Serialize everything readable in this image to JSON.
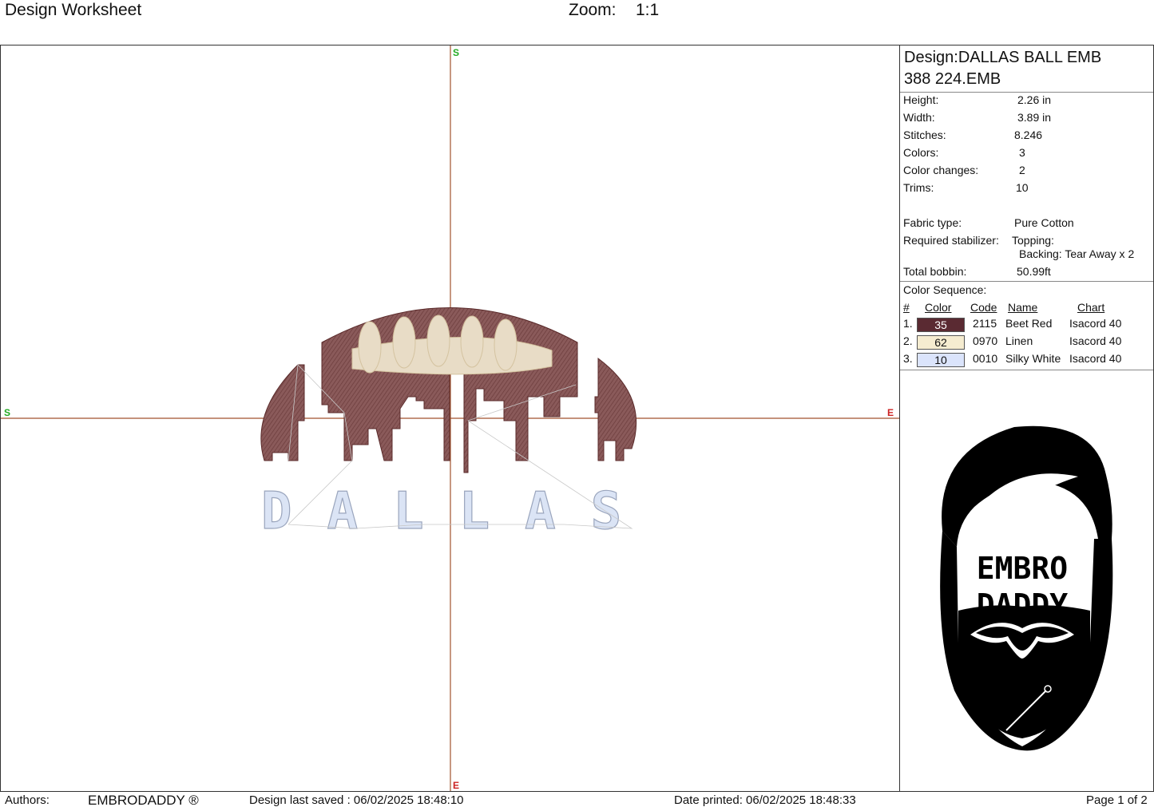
{
  "header": {
    "title": "Design Worksheet",
    "zoom_label": "Zoom:",
    "zoom_value": "1:1"
  },
  "canvas": {
    "markers": {
      "top": "S",
      "left": "S",
      "right": "E",
      "bottom": "E"
    },
    "lettering": "DALLAS",
    "colors": {
      "ball": "#7a4a4a",
      "laces": "#e8dcc6",
      "letters": "#dbe4f5",
      "axis": "#a0522d"
    }
  },
  "info": {
    "design_line1": "Design:DALLAS BALL EMB",
    "design_line2": "388 224.EMB",
    "height_label": "Height:",
    "height_value": "2.26 in",
    "width_label": "Width:",
    "width_value": "3.89 in",
    "stitches_label": "Stitches:",
    "stitches_value": "8.246",
    "colors_label": "Colors:",
    "colors_value": "3",
    "color_changes_label": "Color changes:",
    "color_changes_value": "2",
    "trims_label": "Trims:",
    "trims_value": "10",
    "fabric_label": "Fabric type:",
    "fabric_value": "Pure Cotton",
    "stabilizer_label": "Required stabilizer:",
    "topping_value": "Topping:",
    "backing_value": "Backing: Tear Away x 2",
    "bobbin_label": "Total bobbin:",
    "bobbin_value": "50.99ft"
  },
  "color_sequence": {
    "title": "Color Sequence:",
    "headers": {
      "num": "#",
      "color": "Color",
      "code": "Code",
      "name": "Name",
      "chart": "Chart"
    },
    "rows": [
      {
        "num": "1.",
        "color": "35",
        "code": "2115",
        "name": "Beet Red",
        "chart": "Isacord 40",
        "hex": "#5a2a32",
        "text_color": "#ffffff"
      },
      {
        "num": "2.",
        "color": "62",
        "code": "0970",
        "name": "Linen",
        "chart": "Isacord 40",
        "hex": "#f5ecd0",
        "text_color": "#111111"
      },
      {
        "num": "3.",
        "color": "10",
        "code": "0010",
        "name": "Silky White",
        "chart": "Isacord 40",
        "hex": "#dbe4fb",
        "text_color": "#111111"
      }
    ]
  },
  "logo": {
    "line1": "EMBRO",
    "line2": "DADDY"
  },
  "footer": {
    "authors_label": "Authors:",
    "authors_value": "EMBRODADDY ®",
    "saved": "Design last saved : 06/02/2025 18:48:10",
    "printed": "Date printed: 06/02/2025 18:48:33",
    "page": "Page 1 of 2"
  }
}
